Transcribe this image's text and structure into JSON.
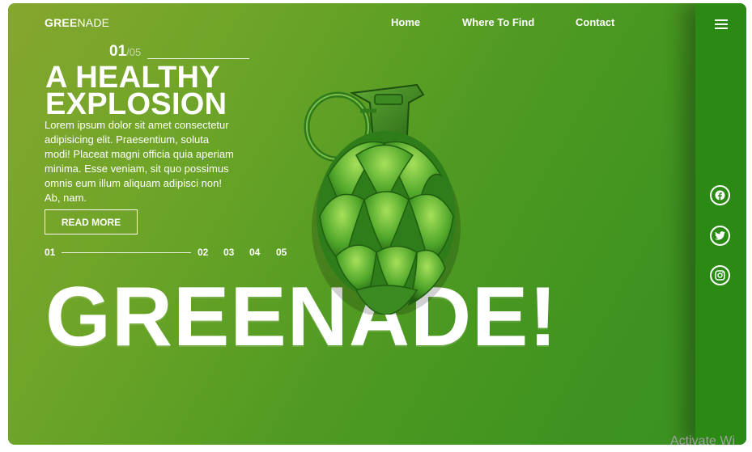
{
  "brand": {
    "bold": "GREE",
    "light": "NADE"
  },
  "nav": {
    "home": "Home",
    "where": "Where To Find",
    "contact": "Contact"
  },
  "slider": {
    "current": "01",
    "total": "/05",
    "items": [
      "01",
      "02",
      "03",
      "04",
      "05"
    ]
  },
  "hero": {
    "headline_line1": "A HEALTHY",
    "headline_line2": "EXPLOSION",
    "body": "Lorem ipsum dolor sit amet consectetur adipisicing elit. Praesentium, soluta modi! Placeat magni officia quia aperiam minima. Esse veniam, sit quo possimus omnis eum illum aliquam adipisci non! Ab, nam.",
    "cta": "READ MORE",
    "big_title": "GREENADE!"
  },
  "social": [
    "facebook-icon",
    "twitter-icon",
    "instagram-icon"
  ],
  "watermark": "Activate Wi",
  "colors": {
    "gradient_start": "#86a62e",
    "gradient_end": "#3a9220",
    "sidebar": "#2a8a14",
    "text": "#ffffff"
  }
}
